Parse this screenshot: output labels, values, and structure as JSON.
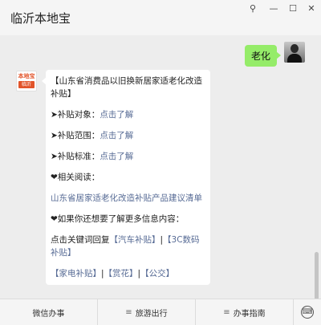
{
  "window": {
    "title": "临沂本地宝",
    "controls": {
      "pin": "⚲",
      "minimize": "—",
      "maximize": "☐",
      "close": "✕"
    }
  },
  "chat": {
    "outgoing": {
      "text": "老化"
    },
    "bot_avatar": {
      "top": "本地宝",
      "bottom": "临沂"
    },
    "incoming": {
      "title": "【山东省消费品以旧换新居家适老化改造补贴】",
      "items": [
        {
          "prefix": "➤补贴对象：",
          "link": "点击了解"
        },
        {
          "prefix": "➤补贴范围：",
          "link": "点击了解"
        },
        {
          "prefix": "➤补贴标准：",
          "link": "点击了解"
        }
      ],
      "related_label": "❤相关阅读：",
      "related_link": "山东省居家适老化改造补贴产品建议清单",
      "more_label": "❤如果你还想要了解更多信息内容：",
      "reply_prefix": "点击关键词回复",
      "keywords_line1": [
        "【汽车补贴】",
        "【3C数码补贴】"
      ],
      "separator": "|",
      "keywords_line2": [
        "【家电补贴】",
        "【赏花】",
        "【公交】"
      ]
    }
  },
  "bottom_menu": {
    "items": [
      {
        "label": "微信办事"
      },
      {
        "label": "旅游出行"
      },
      {
        "label": "办事指南"
      }
    ],
    "menu_glyph": "≡",
    "toggle_glyph": "⌨"
  }
}
